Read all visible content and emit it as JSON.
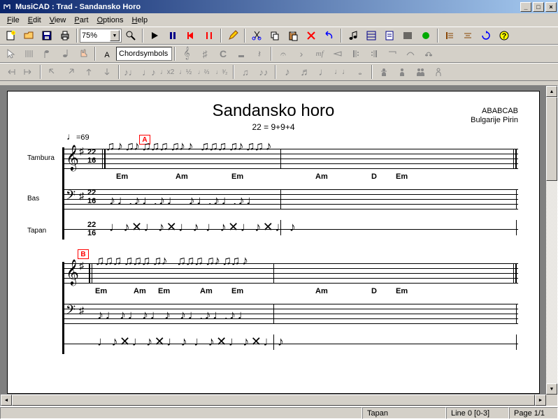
{
  "title": "MusiCAD : Trad - Sandansko Horo",
  "menus": [
    "File",
    "Edit",
    "View",
    "Part",
    "Options",
    "Help"
  ],
  "zoom": "75%",
  "chord_field": "Chordsymbols",
  "sheet": {
    "title": "Sandansko horo",
    "subtitle": "22 = 9+9+4",
    "composer_lines": [
      "ABABCAB",
      "Bulgarije Pirin"
    ],
    "tempo": "=69",
    "rehearsals": [
      "A",
      "B"
    ],
    "instrument_labels": [
      "Tambura",
      "Bas",
      "Tapan"
    ],
    "time_sig_top": "22",
    "time_sig_bot": "16",
    "system1": {
      "chords_row": [
        "Em",
        "Am",
        "Em",
        "Am",
        "D",
        "Em"
      ]
    },
    "system2": {
      "chords_row": [
        "Em",
        "Am",
        "Em",
        "Am",
        "Em",
        "Am",
        "D",
        "Em"
      ]
    }
  },
  "status": {
    "left": "",
    "track": "Tapan",
    "pos": "Line 0 [0-3]",
    "page": "Page 1/1"
  }
}
